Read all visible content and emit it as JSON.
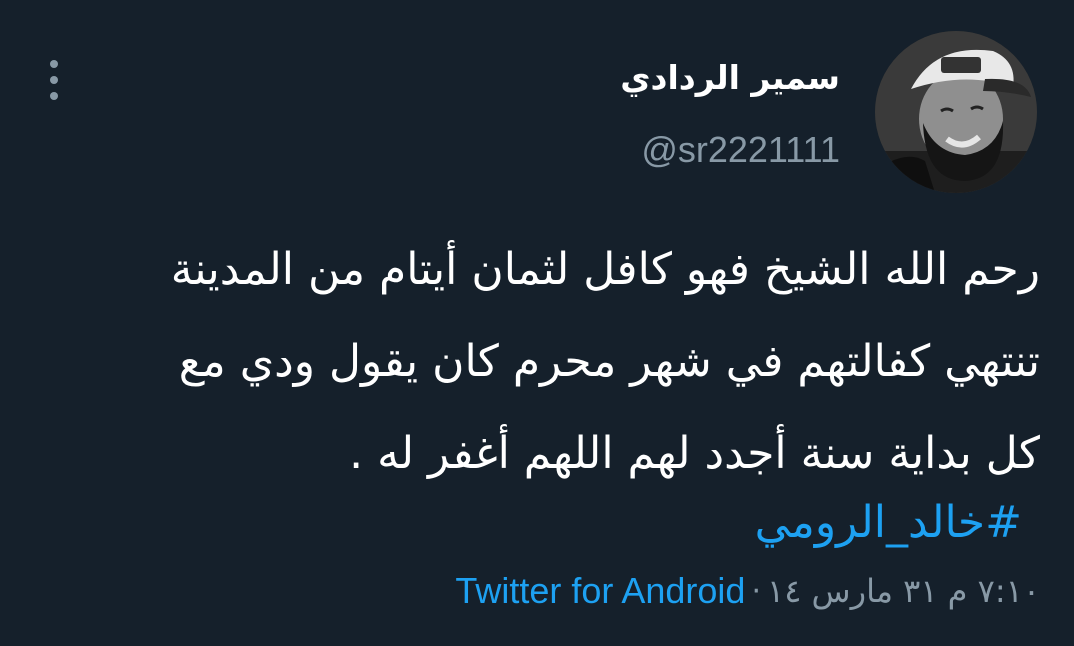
{
  "author": {
    "display_name": "سمير الردادي",
    "handle": "@sr2221111"
  },
  "tweet": {
    "lines": [
      "رحم الله الشيخ فهو كافل لثمان أيتام من المدينة",
      "تنتهي كفالتهم في شهر محرم كان يقول ودي مع",
      "كل بداية سنة أجدد لهم اللهم أغفر له ."
    ],
    "hashtag": "#خالد_الرومي"
  },
  "meta": {
    "timestamp": "٧:١٠ م ٣١ مارس ١٤",
    "separator": "·",
    "source": "Twitter for Android"
  },
  "colors": {
    "background": "#15202b",
    "text": "#ffffff",
    "secondary": "#8899a6",
    "accent": "#1da1f2"
  },
  "icons": {
    "more": "more-vertical-icon",
    "avatar": "profile-photo"
  }
}
